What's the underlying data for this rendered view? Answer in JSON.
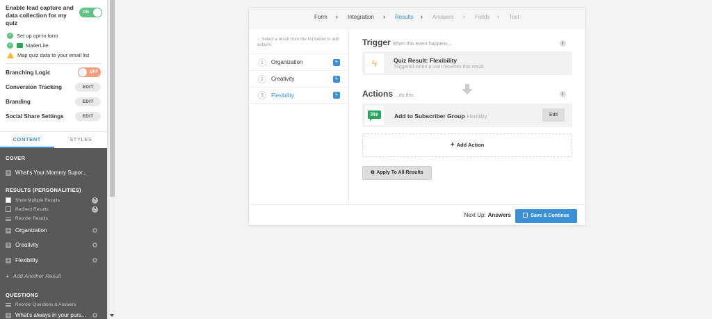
{
  "sidebar": {
    "lead_title": "Enable lead capture and data collection for my quiz",
    "lead_toggle": "ON",
    "checks": [
      {
        "label": "Set up opt-in form",
        "icon": "check-icon"
      },
      {
        "label": "MailerLite",
        "icon": "mailerlite-icon"
      },
      {
        "label": "Map quiz data to your email list",
        "icon": "warning-icon"
      }
    ],
    "settings": {
      "branching": {
        "label": "Branching Logic",
        "toggle": "OFF"
      },
      "conversion": {
        "label": "Conversion Tracking",
        "button": "EDIT"
      },
      "branding": {
        "label": "Branding",
        "button": "EDIT"
      },
      "social": {
        "label": "Social Share Settings",
        "button": "EDIT"
      }
    },
    "tabs": {
      "content": "CONTENT",
      "styles": "STYLES"
    },
    "cover": {
      "heading": "COVER",
      "item": "What's Your Mommy Supor..."
    },
    "results": {
      "heading": "RESULTS (PERSONALITIES)",
      "show_multiple": "Show Multiple Results",
      "redirect": "Redirect Results",
      "reorder": "Reorder Results",
      "items": [
        "Organization",
        "Creativity",
        "Flexibility"
      ],
      "add_another": "Add Another Result"
    },
    "questions": {
      "heading": "QUESTIONS",
      "reorder": "Reorder Questions & Answers",
      "first": "What's always in your purs..."
    }
  },
  "breadcrumb": [
    "Form",
    "Integration",
    "Results",
    "Answers",
    "Fields",
    "Test"
  ],
  "results_panel": {
    "hint": "Select a result from the list below to add actions",
    "items": [
      {
        "num": "1",
        "label": "Organization"
      },
      {
        "num": "2",
        "label": "Creativity"
      },
      {
        "num": "3",
        "label": "Flexibility"
      }
    ]
  },
  "trigger": {
    "title": "Trigger",
    "subtitle": "When this event happens...",
    "box_title": "Quiz Result: Flexibility",
    "box_sub": "Triggered when a user receives this result."
  },
  "actions": {
    "title": "Actions",
    "subtitle": "...do this.",
    "item_title": "Add to Subscriber Group",
    "item_tag": "Flexibility",
    "item_logo": "lite",
    "edit": "Edit",
    "add": "Add Action",
    "apply": "Apply To All Results"
  },
  "footer": {
    "next_up_label": "Next Up:",
    "next_up_value": "Answers",
    "save": "Save & Continue"
  },
  "colors": {
    "accent": "#3a8fd6",
    "on": "#5ec485",
    "off": "#f59e7e",
    "dark_panel": "#595959"
  }
}
